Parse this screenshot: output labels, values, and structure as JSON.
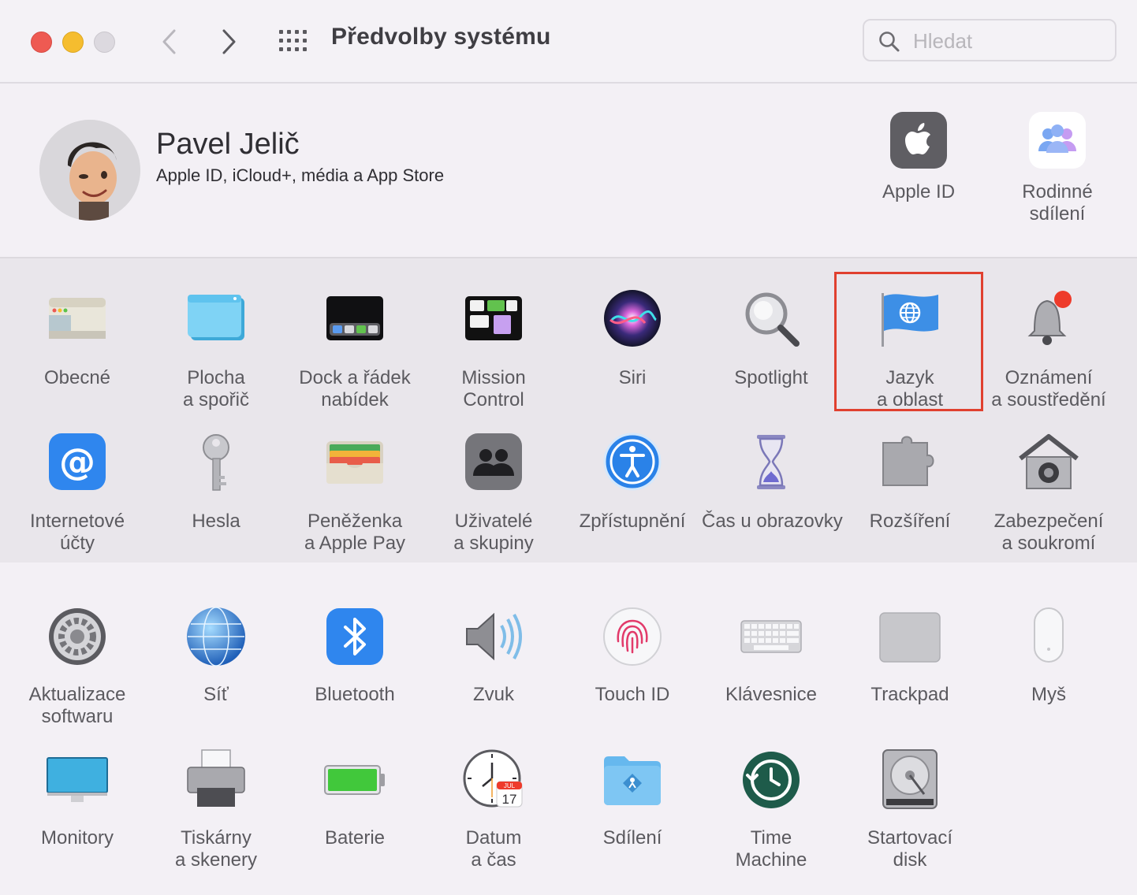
{
  "window": {
    "title": "Předvolby systému",
    "search_placeholder": "Hledat"
  },
  "account": {
    "name": "Pavel Jelič",
    "subtitle": "Apple ID, iCloud+, média a App Store",
    "items": [
      {
        "label_1": "Apple ID",
        "label_2": "",
        "icon": "apple-logo-icon"
      },
      {
        "label_1": "Rodinné",
        "label_2": "sdílení",
        "icon": "family-sharing-icon"
      }
    ]
  },
  "highlight_color": "#e0402f",
  "row1": [
    {
      "l1": "Obecné",
      "l2": ""
    },
    {
      "l1": "Plocha",
      "l2": "a spořič"
    },
    {
      "l1": "Dock a řádek",
      "l2": "nabídek"
    },
    {
      "l1": "Mission",
      "l2": "Control"
    },
    {
      "l1": "Siri",
      "l2": ""
    },
    {
      "l1": "Spotlight",
      "l2": ""
    },
    {
      "l1": "Jazyk",
      "l2": "a oblast"
    },
    {
      "l1": "Oznámení",
      "l2": "a soustředění"
    }
  ],
  "row2": [
    {
      "l1": "Internetové",
      "l2": "účty"
    },
    {
      "l1": "Hesla",
      "l2": ""
    },
    {
      "l1": "Peněženka",
      "l2": "a Apple Pay"
    },
    {
      "l1": "Uživatelé",
      "l2": "a skupiny"
    },
    {
      "l1": "Zpřístupnění",
      "l2": ""
    },
    {
      "l1": "Čas u obrazovky",
      "l2": ""
    },
    {
      "l1": "Rozšíření",
      "l2": ""
    },
    {
      "l1": "Zabezpečení",
      "l2": "a soukromí"
    }
  ],
  "row3": [
    {
      "l1": "Aktualizace",
      "l2": "softwaru"
    },
    {
      "l1": "Síť",
      "l2": ""
    },
    {
      "l1": "Bluetooth",
      "l2": ""
    },
    {
      "l1": "Zvuk",
      "l2": ""
    },
    {
      "l1": "Touch ID",
      "l2": ""
    },
    {
      "l1": "Klávesnice",
      "l2": ""
    },
    {
      "l1": "Trackpad",
      "l2": ""
    },
    {
      "l1": "Myš",
      "l2": ""
    }
  ],
  "row4": [
    {
      "l1": "Monitory",
      "l2": ""
    },
    {
      "l1": "Tiskárny",
      "l2": "a skenery"
    },
    {
      "l1": "Baterie",
      "l2": ""
    },
    {
      "l1": "Datum",
      "l2": "a čas"
    },
    {
      "l1": "Sdílení",
      "l2": ""
    },
    {
      "l1": "Time",
      "l2": "Machine"
    },
    {
      "l1": "Startovací",
      "l2": "disk"
    }
  ],
  "calendar_icon": {
    "month": "JUL",
    "day": "17"
  }
}
